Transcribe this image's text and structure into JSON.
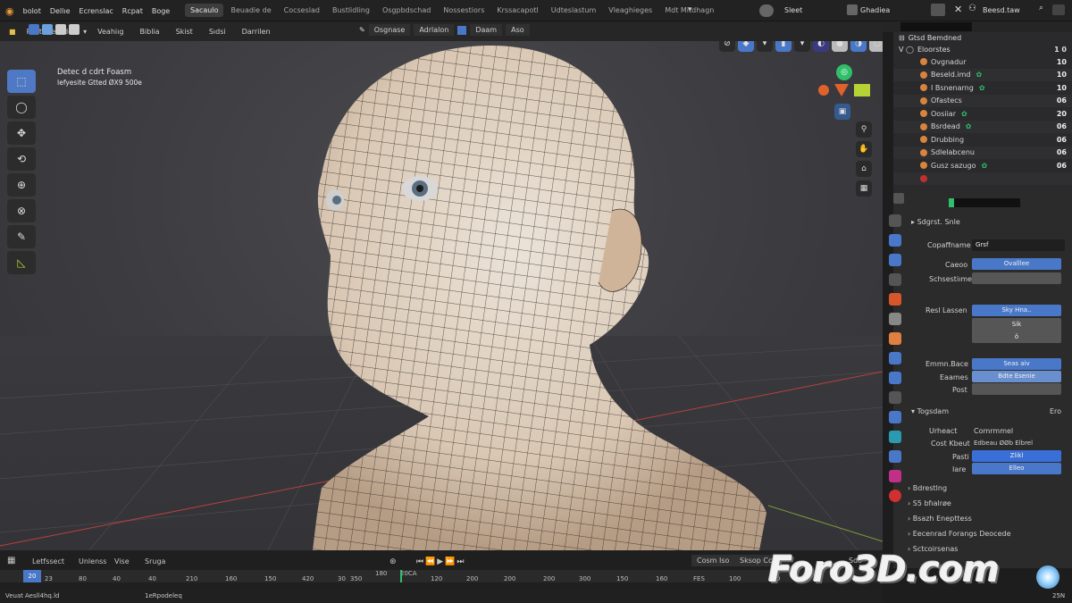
{
  "menu": [
    "bolot",
    "Dellıe",
    "Ecrenslac",
    "Rcpat",
    "Boge"
  ],
  "workspaces": [
    "Sacaulo",
    "Beuadie de",
    "Cocseslad",
    "Bustlidling",
    "Osgpbdschad",
    "Nossestiors",
    "Krssacapotl",
    "Udteslastum",
    "Vleaghieges",
    "Mdt Mitdhagn"
  ],
  "top_right": {
    "status": "Sleet",
    "scene": "Ghadiea",
    "user": "Beesd.taw"
  },
  "header": {
    "mode": "Restnnesede",
    "items": [
      "Veahiıg",
      "Biblia",
      "Skist",
      "Sıdsi",
      "Darrilen"
    ],
    "view_mode": "Osgnase",
    "view_label": "Adrlalon",
    "shading": "Daam",
    "overlay": "Aso"
  },
  "viewport_info": {
    "line1": "Detec d cdrt Foasm",
    "line2": "Iefyesite Gtted ØX9 500e"
  },
  "outliner": {
    "title": "Gtsd Bemdned",
    "collection": "Eloorstes",
    "items": [
      {
        "label": "Ovgnadur",
        "num": "10"
      },
      {
        "label": "Beseld.imd",
        "num": "10"
      },
      {
        "label": "I Bsnenarng",
        "num": "10"
      },
      {
        "label": "Ofastecs",
        "num": "06"
      },
      {
        "label": "Oosiiar",
        "num": "20"
      },
      {
        "label": "Bsrdead",
        "num": "06"
      },
      {
        "label": "Drubbing",
        "num": "06"
      },
      {
        "label": "Sdlelabcenu",
        "num": "06"
      },
      {
        "label": "Gusz sazugo",
        "num": "06"
      },
      {
        "label": "",
        "num": ""
      }
    ]
  },
  "props": {
    "section1": "Sdgrst. Snle",
    "copimame": "Copaffname",
    "copi_value": "Grsf",
    "caeoo": "Caeoo",
    "caeoo_value": "Ovalllee",
    "schlestima": "Schsestiıme",
    "rest_lassen": "Resl Lassen",
    "rest_value": "Sky Hna..",
    "r1": "Sik",
    "r2": "ö",
    "emmn": "Emmn.Bace",
    "emmn_value": "Seas aiv",
    "eaames": "Eaames",
    "eaames_value": "Bdte Esenie",
    "post": "Post",
    "togadam": "Togsdam",
    "togadam_right": "Ero",
    "urheect": "Urheact",
    "urheect_value": "Comrmmel",
    "cost_kbout": "Cost Kbeut",
    "cost_value": "Edbeau ØØb Elbrel",
    "parti": "Pasti",
    "parti_value": "Zlikl",
    "iare": "Iare",
    "iare_value": "Elleo",
    "collapsed": [
      "Bdrestlng",
      "S5 bfıalrøe",
      "Bsazh Enepttess",
      "Eecenrad Forangs Deocede",
      "Sctcoirsenas"
    ]
  },
  "timeline": {
    "labels": [
      "Letfssect",
      "Unlenss",
      "Vise",
      "Sruga"
    ],
    "frame": "20",
    "numbers": [
      "23",
      "80",
      "40",
      "40",
      "210",
      "160",
      "150",
      "420",
      "30",
      "350",
      "180",
      "20CA",
      "120",
      "200",
      "200",
      "200",
      "300",
      "150",
      "160",
      "FES",
      "100",
      "900"
    ],
    "buttons": [
      "Cosm Iso",
      "Sksop Cco",
      "Sdo"
    ],
    "bottom": [
      "Veuat",
      "Aesll4hq.ld",
      "1eRpodeleq",
      "25N"
    ]
  },
  "logo": {
    "text": "Foro3D.com"
  },
  "colors": {
    "accent": "#4a78c8",
    "outliner_bg": "#2a2a2c",
    "orange": "#d8843c",
    "green": "#2fbf6a"
  }
}
